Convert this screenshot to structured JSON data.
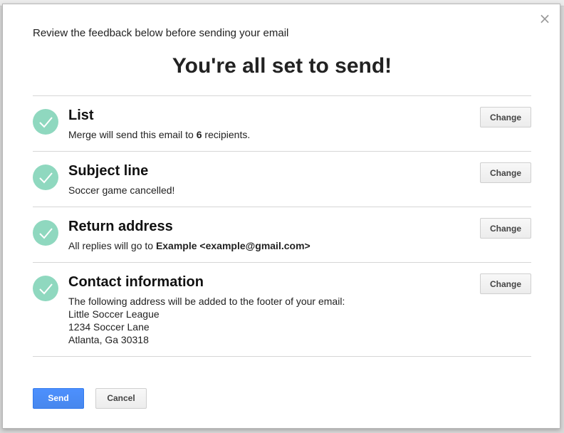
{
  "dialog": {
    "close_icon": "close-icon",
    "intro": "Review the feedback below before sending your email",
    "headline": "You're all set to send!"
  },
  "items": [
    {
      "title": "List",
      "body_prefix": "Merge will send this email to ",
      "body_bold": "6",
      "body_suffix": " recipients.",
      "change_label": "Change"
    },
    {
      "title": "Subject line",
      "body": "Soccer game cancelled!",
      "change_label": "Change"
    },
    {
      "title": "Return address",
      "body_prefix": "All replies will go to ",
      "body_bold": "Example <example@gmail.com>",
      "change_label": "Change"
    },
    {
      "title": "Contact information",
      "body_lines": [
        "The following address will be added to the footer of your email:",
        "Little Soccer League",
        "1234 Soccer Lane",
        "Atlanta, Ga 30318"
      ],
      "change_label": "Change"
    }
  ],
  "footer": {
    "send_label": "Send",
    "cancel_label": "Cancel"
  },
  "colors": {
    "check": "#8fd8bf",
    "send_button": "#4d90fe"
  }
}
